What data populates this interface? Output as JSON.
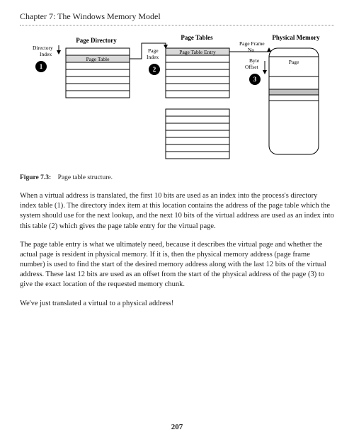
{
  "header": {
    "chapter_title": "Chapter 7: The Windows Memory Model"
  },
  "figure": {
    "labels": {
      "page_directory": "Page Directory",
      "page_tables": "Page Tables",
      "physical_memory": "Physical Memory",
      "directory_index": "Directory\nIndex",
      "page_index": "Page\nIndex",
      "page_frame_no": "Page Frame\nNo",
      "byte_offset": "Byte\nOffset",
      "page_table_cell": "Page Table",
      "page_table_entry_cell": "Page Table Entry",
      "page_cell": "Page"
    },
    "markers": {
      "m1": "1",
      "m2": "2",
      "m3": "3"
    }
  },
  "caption": {
    "label": "Figure 7.3:",
    "text": "Page table structure."
  },
  "paragraphs": {
    "p1": "When a virtual address is translated, the first 10 bits are used as an index into the process's directory index table (1). The directory index item at this location contains the address of the page table which the system should use for the next lookup, and the next 10 bits of the virtual address are used as an index into this table (2) which gives the page table entry for the virtual page.",
    "p2": "The page table entry is what we ultimately need, because it describes the virtual page and whether the actual page is resident in physical memory. If it is, then the physical memory address (page frame number) is used to find the start of the desired memory address along with the last 12 bits of the virtual address. These last 12 bits are used as an offset from the start of the physical address of the page (3) to give the exact location of the requested memory chunk.",
    "p3": "We've just translated a virtual to a physical address!"
  },
  "page_number": "207"
}
